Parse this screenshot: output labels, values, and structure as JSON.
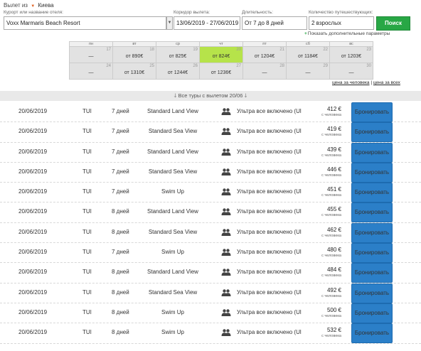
{
  "search": {
    "departure_prefix": "Вылет из",
    "departure_city": "Киева",
    "hotel_label": "Курорт или название отеля:",
    "hotel_value": "Voxx Marmaris Beach Resort",
    "corridor_label": "Коридор вылета:",
    "corridor_value": "13/06/2019 - 27/06/2019",
    "duration_label": "Длительность:",
    "duration_value": "От 7 до 8 дней",
    "travelers_label": "Количество путешествующих:",
    "travelers_value": "2 взрослых",
    "search_button": "Поиск",
    "advanced_link": "Показать дополнительные параметры"
  },
  "calendar": {
    "weekdays": [
      "пн",
      "вт",
      "ср",
      "чт",
      "пт",
      "сб",
      "вс"
    ],
    "weeks": [
      [
        {
          "day": "17",
          "price": "—",
          "selected": false
        },
        {
          "day": "18",
          "price": "от 890€",
          "selected": false
        },
        {
          "day": "19",
          "price": "от 825€",
          "selected": false
        },
        {
          "day": "20",
          "price": "от 824€",
          "selected": true
        },
        {
          "day": "21",
          "price": "от 1204€",
          "selected": false
        },
        {
          "day": "22",
          "price": "от 1184€",
          "selected": false
        },
        {
          "day": "23",
          "price": "от 1203€",
          "selected": false
        }
      ],
      [
        {
          "day": "24",
          "price": "—",
          "selected": false
        },
        {
          "day": "25",
          "price": "от 1310€",
          "selected": false
        },
        {
          "day": "26",
          "price": "от 1244€",
          "selected": false
        },
        {
          "day": "27",
          "price": "от 1236€",
          "selected": false
        },
        {
          "day": "28",
          "price": "—",
          "selected": false
        },
        {
          "day": "29",
          "price": "—",
          "selected": false
        },
        {
          "day": "30",
          "price": "—",
          "selected": false
        }
      ]
    ]
  },
  "price_toggle": {
    "per_person": "цена за человека",
    "separator": "|",
    "total": "цена за всех"
  },
  "all_tours_label": "Все туры с вылетом 20/06",
  "tours": [
    {
      "date": "20/06/2019",
      "operator": "TUI",
      "duration": "7 дней",
      "room": "Standard Land View",
      "meal": "Ультра все включено (Ul",
      "price": "412 €",
      "per": "с человека",
      "book": "Бронировать"
    },
    {
      "date": "20/06/2019",
      "operator": "TUI",
      "duration": "7 дней",
      "room": "Standard Sea View",
      "meal": "Ультра все включено (Ul",
      "price": "419 €",
      "per": "с человека",
      "book": "Бронировать"
    },
    {
      "date": "20/06/2019",
      "operator": "TUI",
      "duration": "7 дней",
      "room": "Standard Land View",
      "meal": "Ультра все включено (Ul",
      "price": "439 €",
      "per": "с человека",
      "book": "Бронировать"
    },
    {
      "date": "20/06/2019",
      "operator": "TUI",
      "duration": "7 дней",
      "room": "Standard Sea View",
      "meal": "Ультра все включено (Ul",
      "price": "446 €",
      "per": "с человека",
      "book": "Бронировать"
    },
    {
      "date": "20/06/2019",
      "operator": "TUI",
      "duration": "7 дней",
      "room": "Swim Up",
      "meal": "Ультра все включено (Ul",
      "price": "451 €",
      "per": "с человека",
      "book": "Бронировать"
    },
    {
      "date": "20/06/2019",
      "operator": "TUI",
      "duration": "8 дней",
      "room": "Standard Land View",
      "meal": "Ультра все включено (Ul",
      "price": "455 €",
      "per": "с человека",
      "book": "Бронировать"
    },
    {
      "date": "20/06/2019",
      "operator": "TUI",
      "duration": "8 дней",
      "room": "Standard Sea View",
      "meal": "Ультра все включено (Ul",
      "price": "462 €",
      "per": "с человека",
      "book": "Бронировать"
    },
    {
      "date": "20/06/2019",
      "operator": "TUI",
      "duration": "7 дней",
      "room": "Swim Up",
      "meal": "Ультра все включено (Ul",
      "price": "480 €",
      "per": "с человека",
      "book": "Бронировать"
    },
    {
      "date": "20/06/2019",
      "operator": "TUI",
      "duration": "8 дней",
      "room": "Standard Land View",
      "meal": "Ультра все включено (Ul",
      "price": "484 €",
      "per": "с человека",
      "book": "Бронировать"
    },
    {
      "date": "20/06/2019",
      "operator": "TUI",
      "duration": "8 дней",
      "room": "Standard Sea View",
      "meal": "Ультра все включено (Ul",
      "price": "492 €",
      "per": "с человека",
      "book": "Бронировать"
    },
    {
      "date": "20/06/2019",
      "operator": "TUI",
      "duration": "8 дней",
      "room": "Swim Up",
      "meal": "Ультра все включено (Ul",
      "price": "500 €",
      "per": "с человека",
      "book": "Бронировать"
    },
    {
      "date": "20/06/2019",
      "operator": "TUI",
      "duration": "8 дней",
      "room": "Swim Up",
      "meal": "Ультра все включено (Ul",
      "price": "532 €",
      "per": "с человека",
      "book": "Бронировать"
    }
  ],
  "colors": {
    "search_green": "#28a745",
    "selected_day": "#b6e34a",
    "book_blue": "#2b7fc8"
  }
}
